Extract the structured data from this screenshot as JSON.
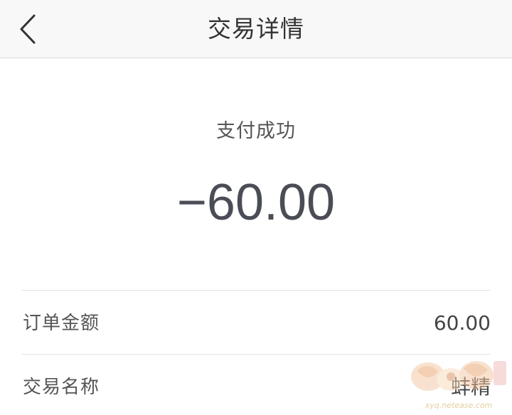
{
  "header": {
    "back_icon": "chevron-left-icon",
    "title": "交易详情"
  },
  "summary": {
    "status": "支付成功",
    "amount": "−60.00"
  },
  "details": [
    {
      "label": "订单金额",
      "value": "60.00"
    },
    {
      "label": "交易名称",
      "value": "蚌精"
    }
  ],
  "watermark": {
    "icon": "game-logo-watermark",
    "text": "xyq.netease.com"
  },
  "colors": {
    "nav_bg": "#f8f8f8",
    "amount_text": "#4a4d55",
    "divider": "#e3e3e3"
  }
}
